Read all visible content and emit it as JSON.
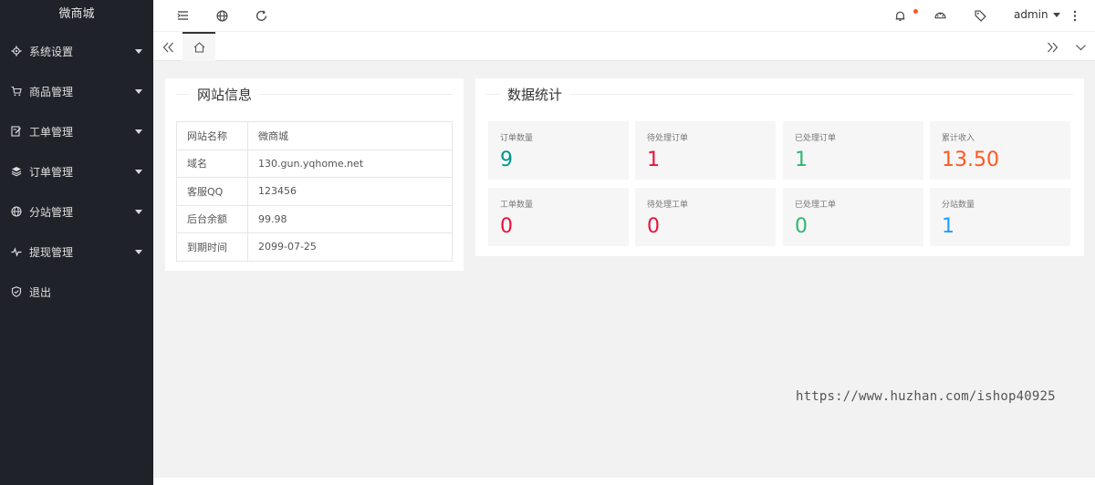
{
  "app": {
    "title": "微商城"
  },
  "sidebar": {
    "items": [
      {
        "label": "系统设置",
        "icon": "gear-icon",
        "has_submenu": true
      },
      {
        "label": "商品管理",
        "icon": "cart-icon",
        "has_submenu": true
      },
      {
        "label": "工单管理",
        "icon": "edit-icon",
        "has_submenu": true
      },
      {
        "label": "订单管理",
        "icon": "layers-icon",
        "has_submenu": true
      },
      {
        "label": "分站管理",
        "icon": "globe-icon",
        "has_submenu": true
      },
      {
        "label": "提现管理",
        "icon": "pulse-icon",
        "has_submenu": true
      },
      {
        "label": "退出",
        "icon": "shield-icon",
        "has_submenu": false
      }
    ]
  },
  "header": {
    "user": "admin",
    "icons": [
      "menu-toggle-icon",
      "globe-icon",
      "refresh-icon",
      "bell-icon",
      "theme-icon",
      "tag-icon",
      "more-icon"
    ],
    "notification_dot_color": "#ff5722"
  },
  "tabs": {
    "home_icon": "home-icon"
  },
  "site_info": {
    "title": "网站信息",
    "rows": [
      {
        "key": "网站名称",
        "value": "微商城"
      },
      {
        "key": "域名",
        "value": "130.gun.yqhome.net"
      },
      {
        "key": "客服QQ",
        "value": "123456"
      },
      {
        "key": "后台余额",
        "value": "99.98"
      },
      {
        "key": "到期时间",
        "value": "2099-07-25"
      }
    ]
  },
  "stats": {
    "title": "数据统计",
    "items": [
      {
        "label": "订单数量",
        "value": "9",
        "color": "#009688"
      },
      {
        "label": "待处理订单",
        "value": "1",
        "color": "#e8113d"
      },
      {
        "label": "已处理订单",
        "value": "1",
        "color": "#2eb872"
      },
      {
        "label": "累计收入",
        "value": "13.50",
        "color": "#ff5722"
      },
      {
        "label": "工单数量",
        "value": "0",
        "color": "#e8113d"
      },
      {
        "label": "待处理工单",
        "value": "0",
        "color": "#e8113d"
      },
      {
        "label": "已处理工单",
        "value": "0",
        "color": "#2eb872"
      },
      {
        "label": "分站数量",
        "value": "1",
        "color": "#1e9fff"
      }
    ]
  },
  "watermark": "https://www.huzhan.com/ishop40925"
}
